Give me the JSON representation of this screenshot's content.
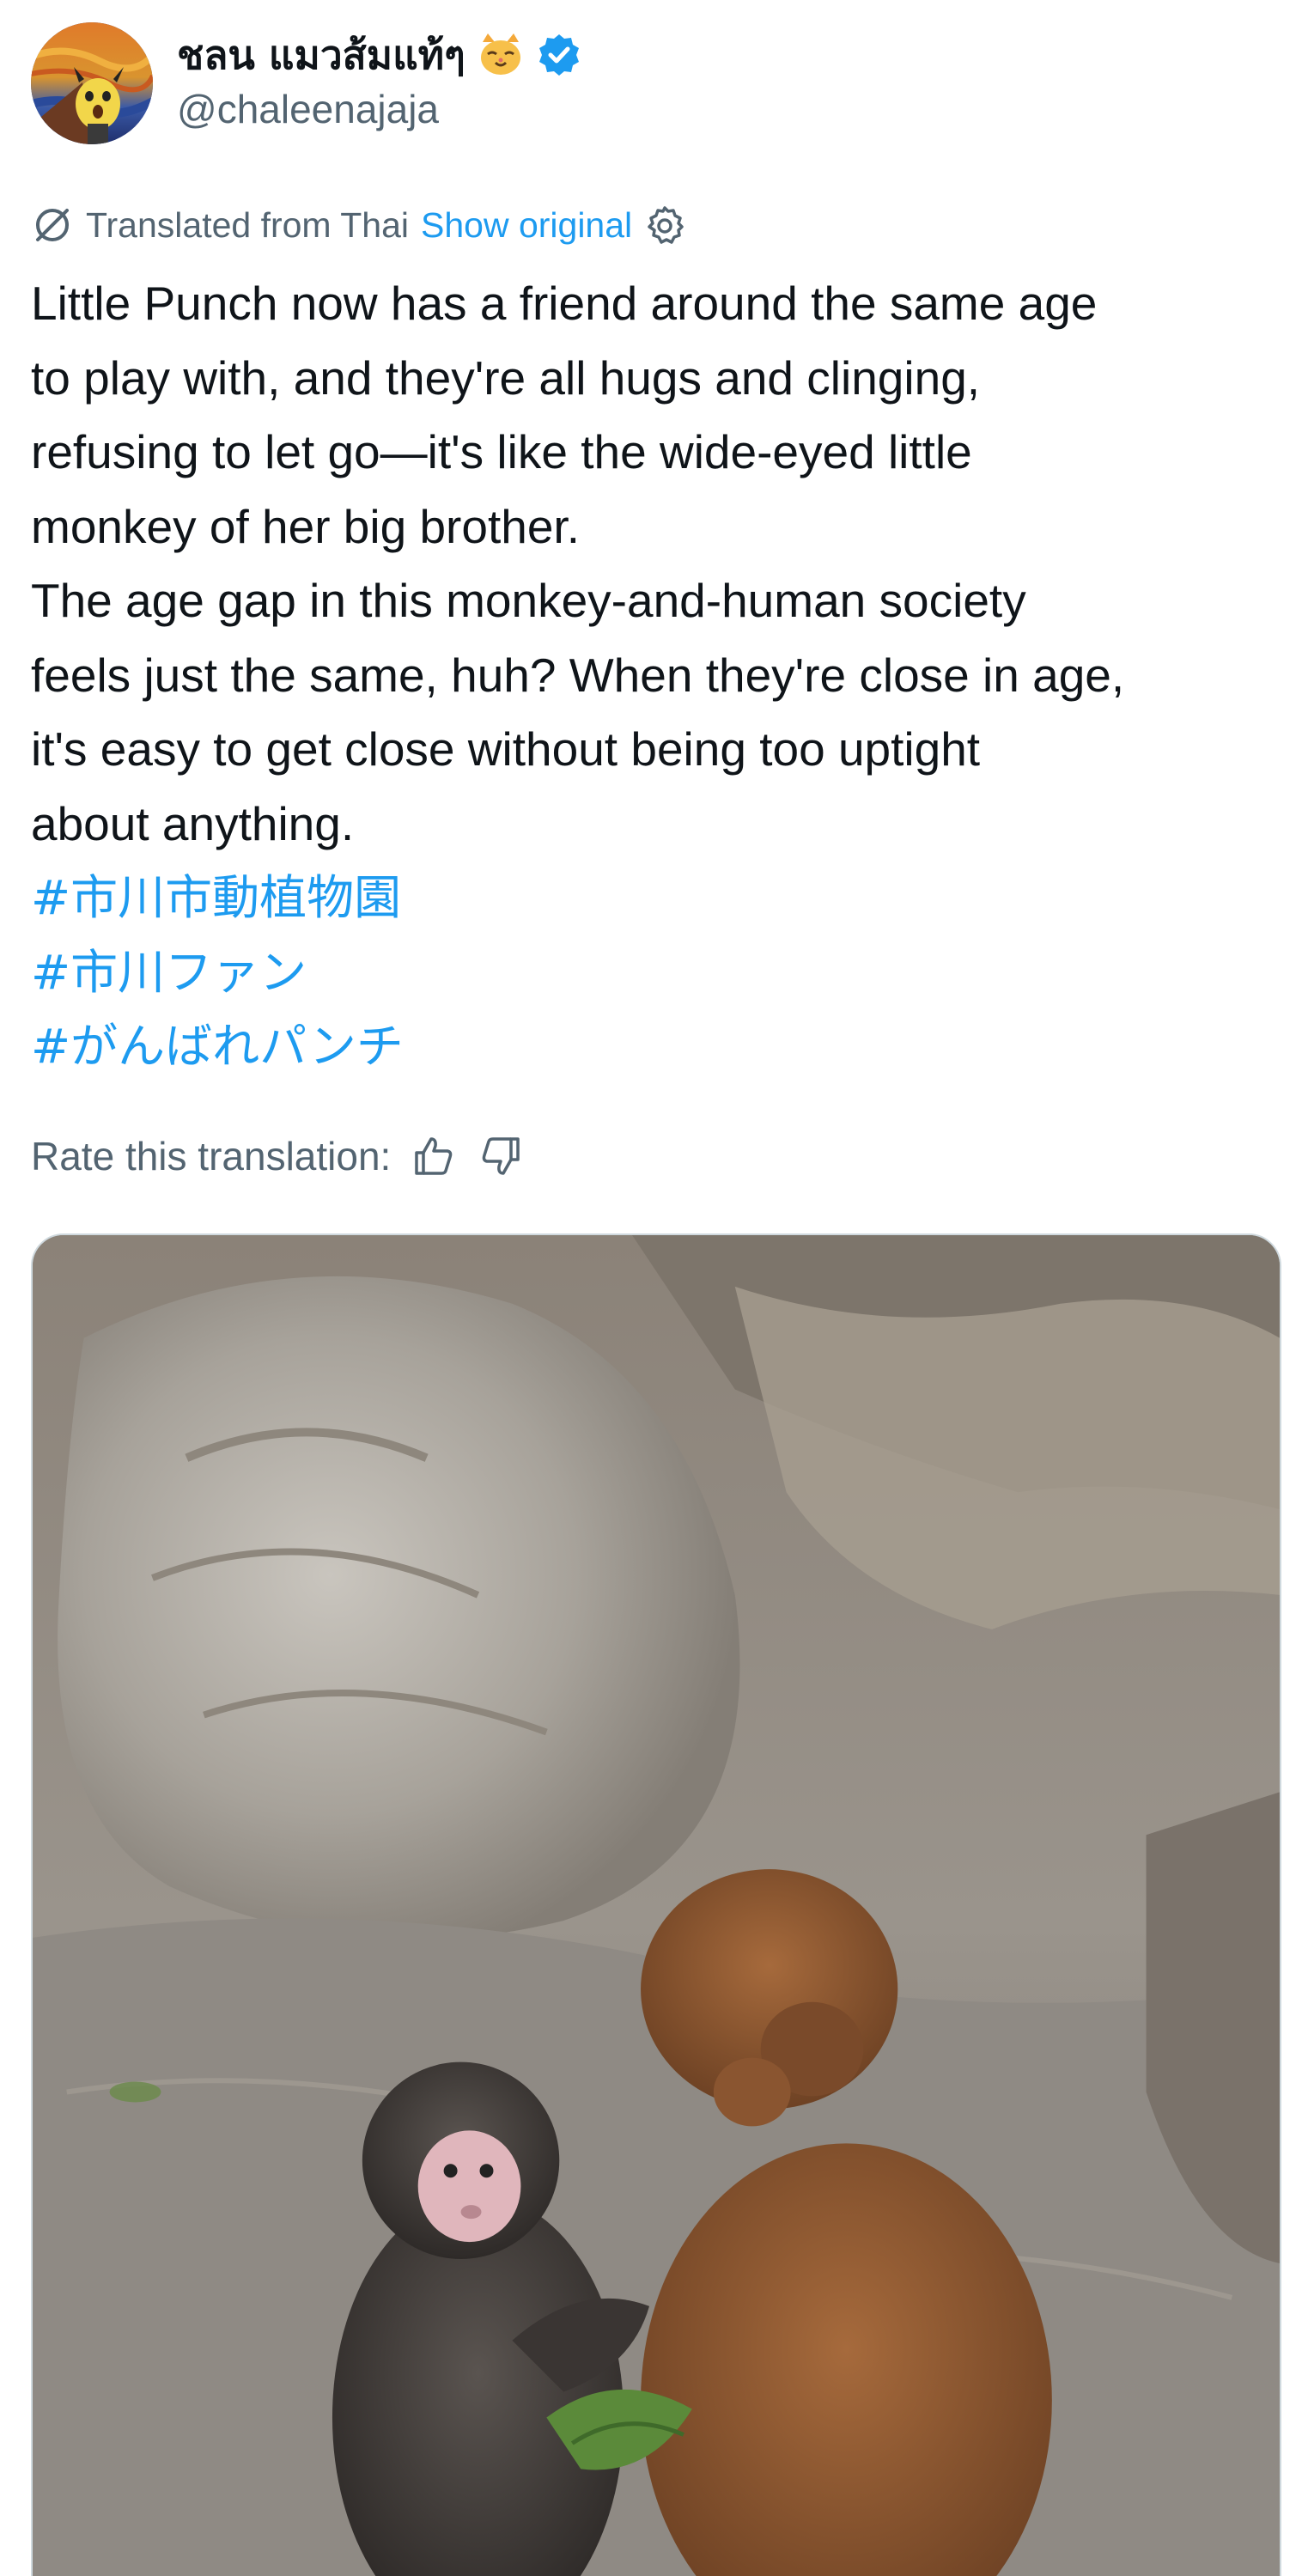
{
  "author": {
    "display_name": "ชลน แมวส้มแท้ๆ",
    "handle": "@chaleenajaja",
    "verified": true,
    "avatar_icon": "scream-painting-avatar",
    "badge_icon": "verified-badge-icon",
    "emoji_icon": "cat-face-emoji"
  },
  "translation": {
    "label": "Translated from Thai",
    "show_original": "Show original",
    "settings_icon": "gear-icon"
  },
  "tweet": {
    "lines": [
      "Little Punch now has a friend around the same age",
      "to play with, and they're all hugs and clinging,",
      "refusing to let go—it's like the wide-eyed little",
      "monkey of her big brother.",
      "The age gap in this monkey-and-human society",
      "feels just the same, huh? When they're close in age,",
      "it's easy to get close without being too uptight",
      "about anything."
    ],
    "hashtags": [
      "#市川市動植物園",
      "#市川ファン",
      "#がんばれパンチ"
    ]
  },
  "rating": {
    "label": "Rate this translation:",
    "like_icon": "thumbs-up-icon",
    "dislike_icon": "thumbs-down-icon"
  },
  "media": {
    "type": "photo",
    "subject_icon": "two-baby-monkeys-photo"
  },
  "colors": {
    "link": "#1d9bf0",
    "secondary_text": "#536471",
    "primary_text": "#0f1419",
    "verified": "#1d9bf0"
  }
}
